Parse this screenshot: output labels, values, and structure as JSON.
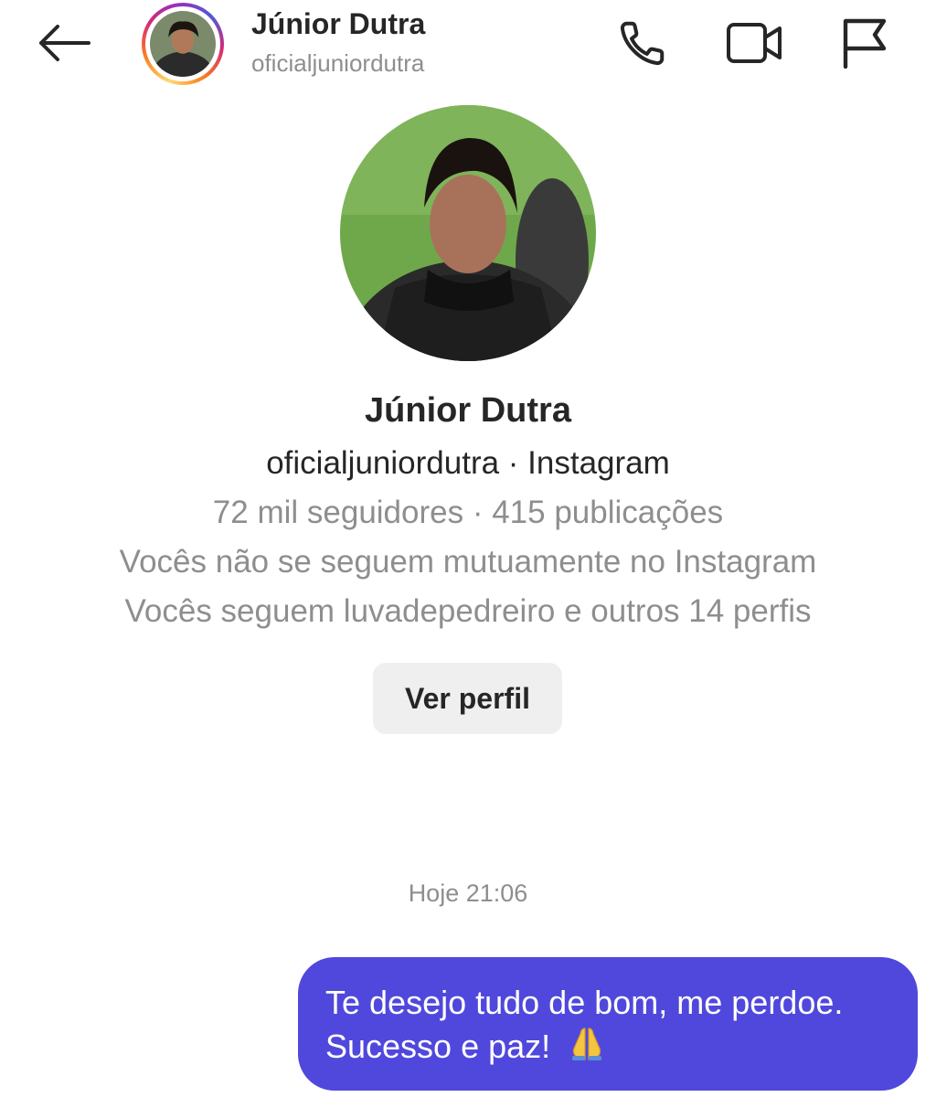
{
  "header": {
    "name": "Júnior Dutra",
    "username": "oficialjuniordutra"
  },
  "profile": {
    "name": "Júnior Dutra",
    "handle_line": "oficialjuniordutra · Instagram",
    "stats_line": "72 mil seguidores · 415 publicações",
    "mutual_line": "Vocês não se seguem mutuamente no Instagram",
    "following_line": "Vocês seguem luvadepedreiro e outros 14 perfis",
    "view_profile_label": "Ver perfil"
  },
  "conversation": {
    "timestamp": "Hoje 21:06",
    "messages": [
      {
        "line1": "Te desejo tudo de bom, me perdoe.",
        "line2": "Sucesso e paz!"
      }
    ]
  },
  "icons": {
    "back": "arrow-left-icon",
    "call": "phone-icon",
    "video": "video-camera-icon",
    "report": "flag-icon",
    "emoji": "folded-hands-emoji"
  },
  "colors": {
    "bubble": "#5048dc",
    "secondary_text": "#8e8e8e",
    "button_bg": "#efefef"
  }
}
